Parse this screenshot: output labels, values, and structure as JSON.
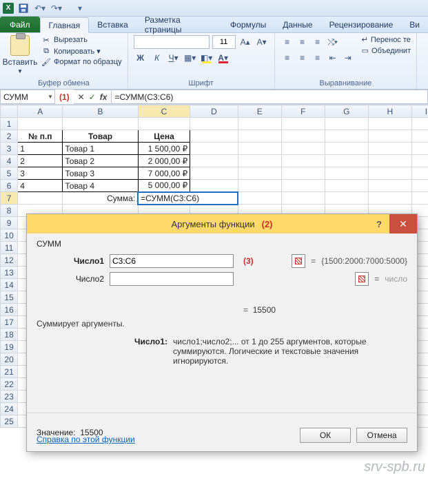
{
  "qat": {
    "save_icon": "save",
    "undo_icon": "undo",
    "redo_icon": "redo"
  },
  "tabs": {
    "file": "Файл",
    "items": [
      "Главная",
      "Вставка",
      "Разметка страницы",
      "Формулы",
      "Данные",
      "Рецензирование",
      "Ви"
    ],
    "active_index": 0
  },
  "ribbon": {
    "paste": "Вставить",
    "cut": "Вырезать",
    "copy": "Копировать ▾",
    "format_painter": "Формат по образцу",
    "clipboard_title": "Буфер обмена",
    "font_title": "Шрифт",
    "align_title": "Выравнивание",
    "font_name": "",
    "font_size": "11",
    "wrap": "Перенос те",
    "merge": "Объединит"
  },
  "formula_bar": {
    "name_box": "СУММ",
    "callout_1": "(1)",
    "cancel": "✕",
    "accept": "✓",
    "fx": "fx",
    "formula": "=СУММ(C3:C6)"
  },
  "columns": [
    "A",
    "B",
    "C",
    "D",
    "E",
    "F",
    "G",
    "H",
    "I"
  ],
  "row_headers": [
    1,
    2,
    3,
    4,
    5,
    6,
    7,
    8,
    9,
    10,
    11,
    12,
    13,
    14,
    15,
    16,
    17,
    18,
    19,
    20,
    21,
    22,
    23,
    24,
    25
  ],
  "table": {
    "hdr": {
      "a": "№ п.п",
      "b": "Товар",
      "c": "Цена"
    },
    "rows": [
      {
        "a": "1",
        "b": "Товар 1",
        "c": "1 500,00 ₽"
      },
      {
        "a": "2",
        "b": "Товар 2",
        "c": "2 000,00 ₽"
      },
      {
        "a": "3",
        "b": "Товар 3",
        "c": "7 000,00 ₽"
      },
      {
        "a": "4",
        "b": "Товар 4",
        "c": "5 000,00 ₽"
      }
    ],
    "sum_label": "Сумма:",
    "sum_formula": "=СУММ(C3:C6)"
  },
  "dialog": {
    "title": "Аргументы функции",
    "callout_2": "(2)",
    "help": "?",
    "close": "✕",
    "fn": "СУММ",
    "arg1_label": "Число1",
    "arg1_value": "C3:C6",
    "callout_3": "(3)",
    "arg1_preview": "{1500:2000:7000:5000}",
    "arg2_label": "Число2",
    "arg2_value": "",
    "arg2_preview": "число",
    "eq": "=",
    "result_inline": "15500",
    "desc": "Суммирует аргументы.",
    "argdesc_label": "Число1:",
    "argdesc_text": "число1;число2;... от 1 до 255 аргументов, которые суммируются. Логические и текстовые значения игнорируются.",
    "value_label": "Значение:",
    "value": "15500",
    "help_link": "Справка по этой функции",
    "ok": "ОК",
    "cancel": "Отмена"
  },
  "watermark": "srv-spb.ru"
}
